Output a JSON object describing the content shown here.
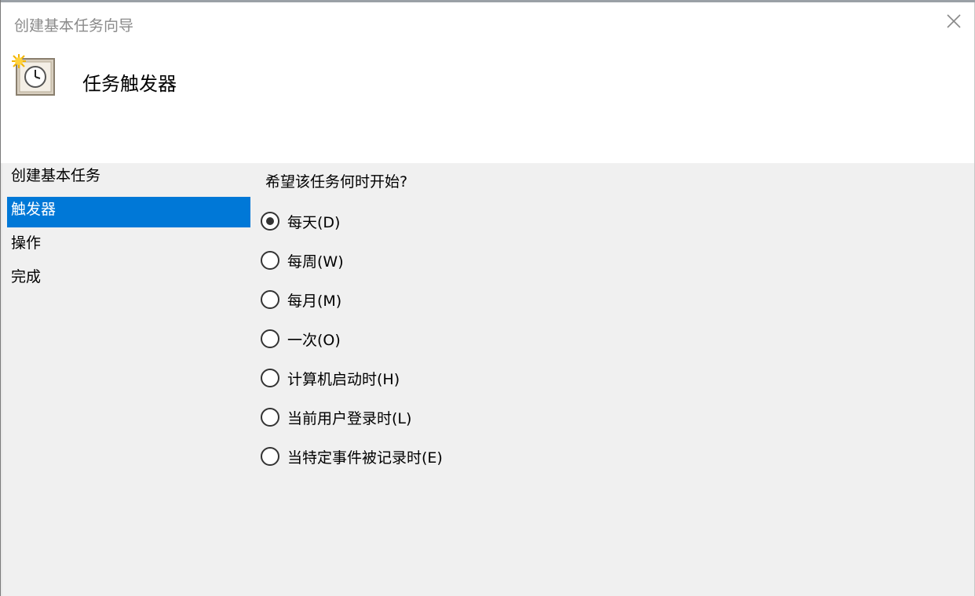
{
  "window": {
    "title": "创建基本任务向导"
  },
  "header": {
    "title": "任务触发器",
    "icon": "task-clock-icon"
  },
  "sidebar": {
    "items": [
      {
        "label": "创建基本任务",
        "active": false
      },
      {
        "label": "触发器",
        "active": true
      },
      {
        "label": "操作",
        "active": false
      },
      {
        "label": "完成",
        "active": false
      }
    ]
  },
  "content": {
    "question": "希望该任务何时开始?",
    "options": [
      {
        "label": "每天(D)",
        "selected": true
      },
      {
        "label": "每周(W)",
        "selected": false
      },
      {
        "label": "每月(M)",
        "selected": false
      },
      {
        "label": "一次(O)",
        "selected": false
      },
      {
        "label": "计算机启动时(H)",
        "selected": false
      },
      {
        "label": "当前用户登录时(L)",
        "selected": false
      },
      {
        "label": "当特定事件被记录时(E)",
        "selected": false
      }
    ]
  },
  "colors": {
    "selection": "#0078d7",
    "background": "#f0f0f0"
  }
}
